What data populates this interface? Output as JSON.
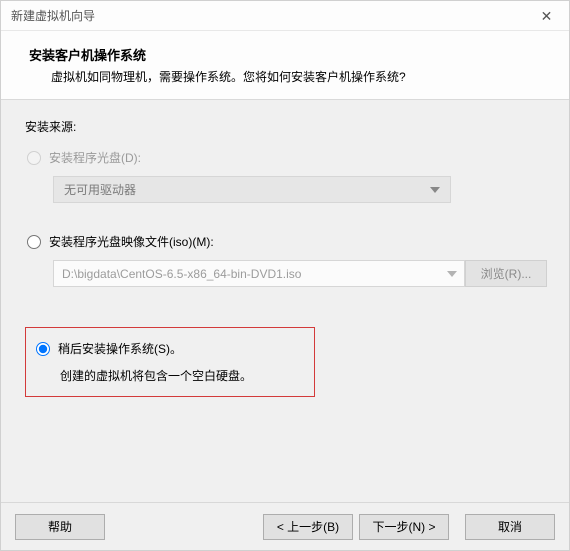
{
  "window": {
    "title": "新建虚拟机向导"
  },
  "header": {
    "heading": "安装客户机操作系统",
    "subtitle": "虚拟机如同物理机，需要操作系统。您将如何安装客户机操作系统?"
  },
  "source": {
    "label": "安装来源:",
    "opt_disc": "安装程序光盘(D):",
    "disc_combo": "无可用驱动器",
    "opt_iso": "安装程序光盘映像文件(iso)(M):",
    "iso_value": "D:\\bigdata\\CentOS-6.5-x86_64-bin-DVD1.iso",
    "browse": "浏览(R)...",
    "opt_later": "稍后安装操作系统(S)。",
    "later_desc": "创建的虚拟机将包含一个空白硬盘。"
  },
  "footer": {
    "help": "帮助",
    "back": "< 上一步(B)",
    "next": "下一步(N) >",
    "cancel": "取消"
  }
}
